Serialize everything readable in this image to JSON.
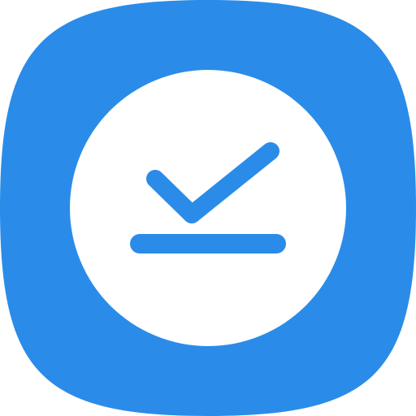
{
  "icon": {
    "name": "task-complete-app-icon",
    "background_color": "#2A8CE8",
    "circle_color": "#FFFFFF",
    "glyph_color": "#2A8CE8",
    "glyph": "check-mark-above-line"
  }
}
